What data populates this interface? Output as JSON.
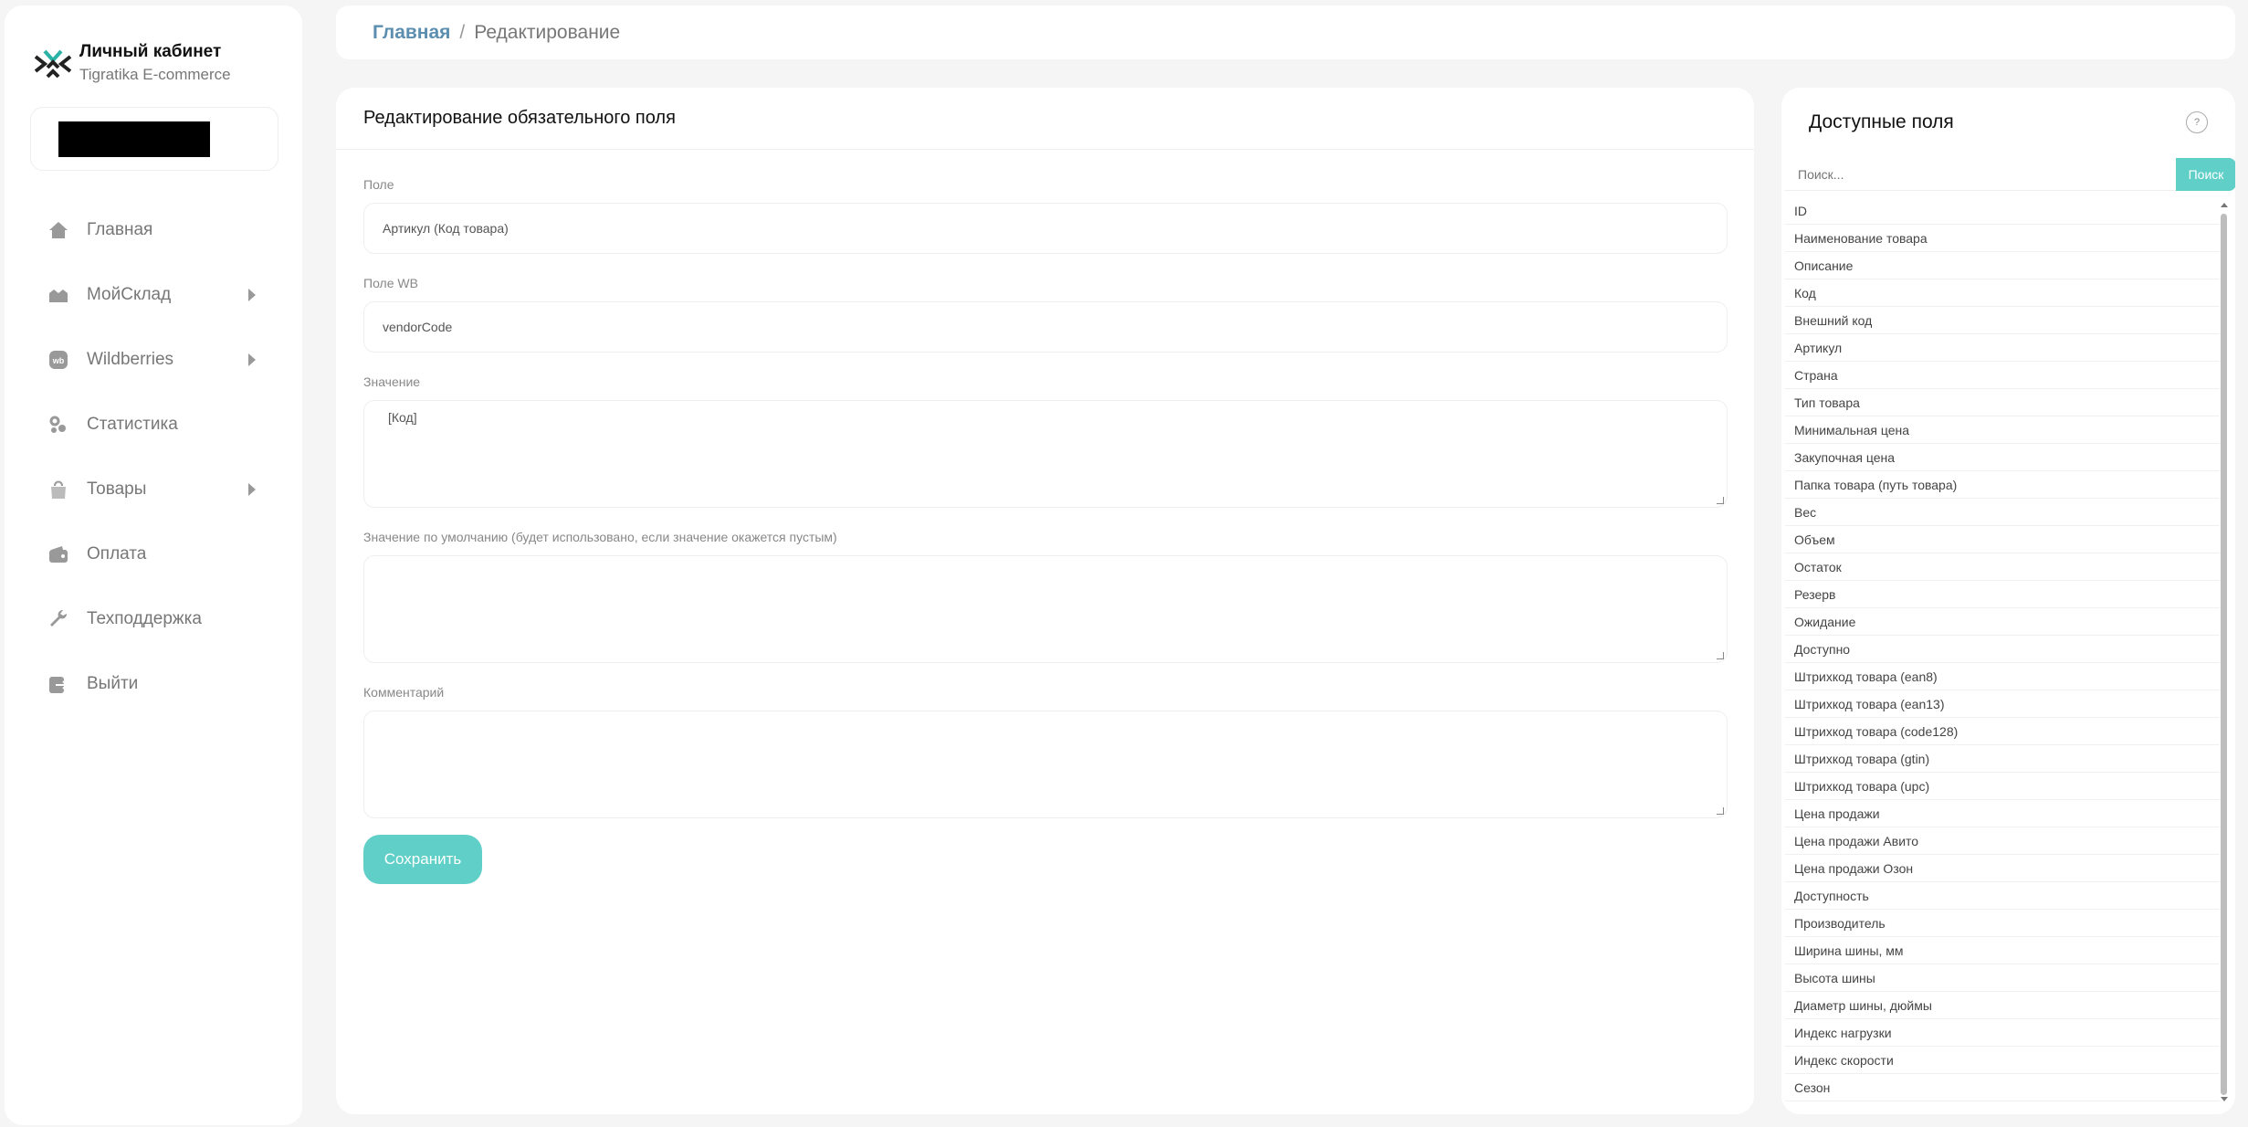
{
  "brand": {
    "title": "Личный кабинет",
    "subtitle": "Tigratika E-commerce"
  },
  "sidebar": {
    "items": [
      {
        "label": "Главная",
        "icon": "home-icon",
        "has_submenu": false
      },
      {
        "label": "МойСклад",
        "icon": "warehouse-icon",
        "has_submenu": true
      },
      {
        "label": "Wildberries",
        "icon": "wb-icon",
        "has_submenu": true
      },
      {
        "label": "Статистика",
        "icon": "statistics-icon",
        "has_submenu": false
      },
      {
        "label": "Товары",
        "icon": "bag-icon",
        "has_submenu": true
      },
      {
        "label": "Оплата",
        "icon": "wallet-icon",
        "has_submenu": false
      },
      {
        "label": "Техподдержка",
        "icon": "wrench-icon",
        "has_submenu": false
      },
      {
        "label": "Выйти",
        "icon": "logout-icon",
        "has_submenu": false
      }
    ]
  },
  "breadcrumb": {
    "home": "Главная",
    "separator": "/",
    "current": "Редактирование"
  },
  "form": {
    "title": "Редактирование обязательного поля",
    "field_label": "Поле",
    "field_value": "Артикул (Код товара)",
    "wb_label": "Поле WB",
    "wb_value": "vendorCode",
    "value_label": "Значение",
    "value_value": "[Код]",
    "default_label": "Значение по умолчанию (будет использовано, если значение окажется пустым)",
    "default_value": "",
    "comment_label": "Комментарий",
    "comment_value": "",
    "save_label": "Сохранить"
  },
  "fields_panel": {
    "title": "Доступные поля",
    "help": "?",
    "search_placeholder": "Поиск...",
    "search_button": "Поиск",
    "items": [
      "ID",
      "Наименование товара",
      "Описание",
      "Код",
      "Внешний код",
      "Артикул",
      "Страна",
      "Тип товара",
      "Минимальная цена",
      "Закупочная цена",
      "Папка товара (путь товара)",
      "Вес",
      "Объем",
      "Остаток",
      "Резерв",
      "Ожидание",
      "Доступно",
      "Штрихкод товара (ean8)",
      "Штрихкод товара (ean13)",
      "Штрихкод товара (code128)",
      "Штрихкод товара (gtin)",
      "Штрихкод товара (upc)",
      "Цена продажи",
      "Цена продажи Авито",
      "Цена продажи Озон",
      "Доступность",
      "Производитель",
      "Ширина шины, мм",
      "Высота шины",
      "Диаметр шины, дюймы",
      "Индекс нагрузки",
      "Индекс скорости",
      "Сезон"
    ]
  },
  "colors": {
    "accent": "#5fcfc7",
    "link": "#5b8eaf",
    "background": "#f5f5f5"
  }
}
